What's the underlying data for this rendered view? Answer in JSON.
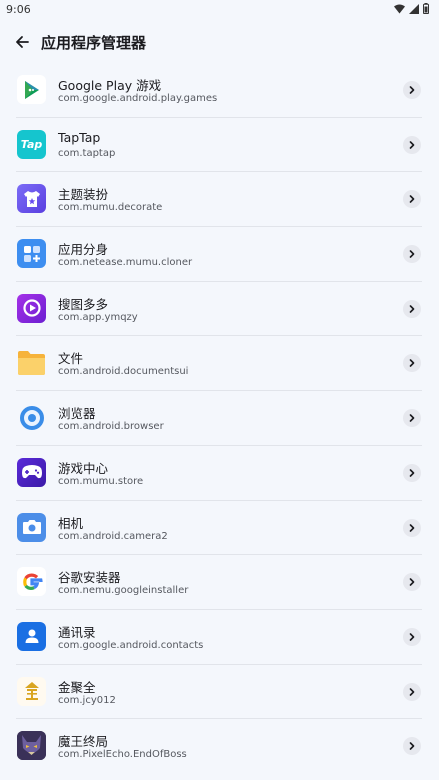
{
  "status_bar": {
    "time": "9:06"
  },
  "header": {
    "title": "应用程序管理器"
  },
  "apps": [
    {
      "name": "Google Play 游戏",
      "package": "com.google.android.play.games",
      "icon": "google-play-games-icon"
    },
    {
      "name": "TapTap",
      "package": "com.taptap",
      "icon": "taptap-icon",
      "icon_text": "Tap"
    },
    {
      "name": "主题装扮",
      "package": "com.mumu.decorate",
      "icon": "theme-decorate-icon"
    },
    {
      "name": "应用分身",
      "package": "com.netease.mumu.cloner",
      "icon": "app-cloner-icon"
    },
    {
      "name": "搜图多多",
      "package": "com.app.ymqzy",
      "icon": "image-search-icon"
    },
    {
      "name": "文件",
      "package": "com.android.documentsui",
      "icon": "folder-icon"
    },
    {
      "name": "浏览器",
      "package": "com.android.browser",
      "icon": "browser-icon"
    },
    {
      "name": "游戏中心",
      "package": "com.mumu.store",
      "icon": "game-center-icon"
    },
    {
      "name": "相机",
      "package": "com.android.camera2",
      "icon": "camera-icon"
    },
    {
      "name": "谷歌安装器",
      "package": "com.nemu.googleinstaller",
      "icon": "google-installer-icon"
    },
    {
      "name": "通讯录",
      "package": "com.google.android.contacts",
      "icon": "contacts-icon"
    },
    {
      "name": "金聚全",
      "package": "com.jcy012",
      "icon": "jinjuquan-icon"
    },
    {
      "name": "魔王终局",
      "package": "com.PixelEcho.EndOfBoss",
      "icon": "end-of-boss-icon"
    }
  ],
  "colors": {
    "background": "#f4f7fc",
    "divider": "#e1e4ea",
    "chevron_bg": "#e6e8ee"
  }
}
